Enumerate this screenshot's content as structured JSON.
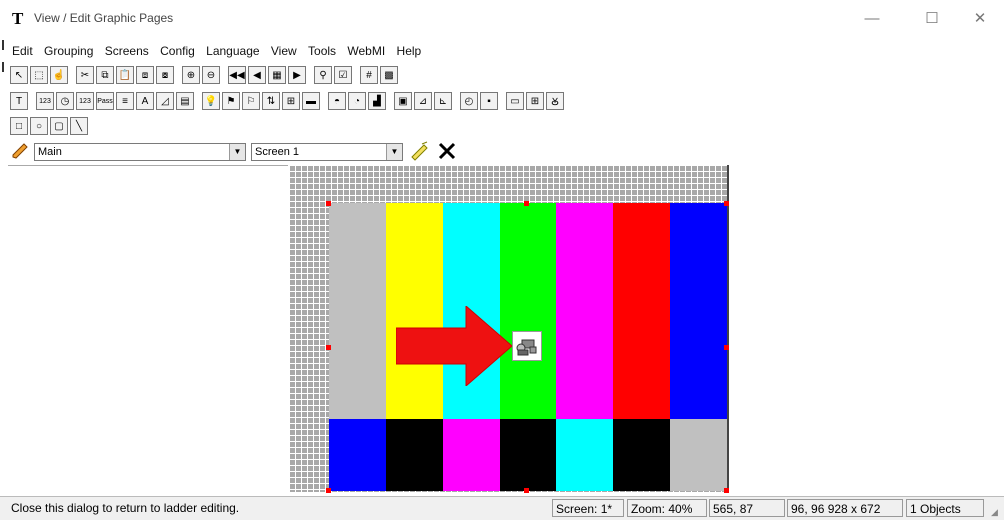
{
  "window": {
    "title": "View / Edit Graphic Pages",
    "icon_glyph": "T",
    "buttons": {
      "minimize": "—",
      "maximize": "☐",
      "close": "✕"
    }
  },
  "menu": [
    "Edit",
    "Grouping",
    "Screens",
    "Config",
    "Language",
    "View",
    "Tools",
    "WebMI",
    "Help"
  ],
  "toolbar1": [
    {
      "name": "pointer-icon",
      "glyph": "↖"
    },
    {
      "name": "select-region-icon",
      "glyph": "⬚"
    },
    {
      "name": "hand-icon",
      "glyph": "☝"
    },
    {
      "name": "cut-icon",
      "glyph": "✂"
    },
    {
      "name": "copy-icon",
      "glyph": "⧉"
    },
    {
      "name": "paste-icon",
      "glyph": "📋"
    },
    {
      "name": "bring-front-icon",
      "glyph": "⧈"
    },
    {
      "name": "send-back-icon",
      "glyph": "⧇"
    },
    {
      "name": "zoom-in-icon",
      "glyph": "⊕"
    },
    {
      "name": "zoom-out-icon",
      "glyph": "⊖"
    },
    {
      "name": "first-screen-icon",
      "glyph": "◀◀"
    },
    {
      "name": "prev-screen-icon",
      "glyph": "◀"
    },
    {
      "name": "screen-list-icon",
      "glyph": "▦"
    },
    {
      "name": "next-screen-icon",
      "glyph": "▶"
    },
    {
      "name": "find-icon",
      "glyph": "⚲"
    },
    {
      "name": "properties-icon",
      "glyph": "☑"
    },
    {
      "name": "grid-icon",
      "glyph": "#"
    },
    {
      "name": "grid-fill-icon",
      "glyph": "▩"
    }
  ],
  "toolbar2": [
    {
      "name": "text-icon",
      "glyph": "T"
    },
    {
      "name": "numeric-display-icon",
      "glyph": "123"
    },
    {
      "name": "clock-icon",
      "glyph": "◷"
    },
    {
      "name": "numeric-entry-icon",
      "glyph": "123"
    },
    {
      "name": "pass-icon",
      "glyph": "Pass"
    },
    {
      "name": "message-icon",
      "glyph": "≡"
    },
    {
      "name": "text-entry-icon",
      "glyph": "A"
    },
    {
      "name": "scale-icon",
      "glyph": "◿"
    },
    {
      "name": "table-icon",
      "glyph": "▤"
    },
    {
      "name": "lightbulb-icon",
      "glyph": "💡"
    },
    {
      "name": "flag-icon",
      "glyph": "⚑"
    },
    {
      "name": "multi-flag-icon",
      "glyph": "⚐"
    },
    {
      "name": "switch-icon",
      "glyph": "⇅"
    },
    {
      "name": "screen-button-icon",
      "glyph": "⊞"
    },
    {
      "name": "bar-graph-icon",
      "glyph": "▬"
    },
    {
      "name": "dome-light-icon",
      "glyph": "◓"
    },
    {
      "name": "meter-icon",
      "glyph": "◔"
    },
    {
      "name": "chart-icon",
      "glyph": "▟"
    },
    {
      "name": "calendar-icon",
      "glyph": "▣"
    },
    {
      "name": "trend-icon",
      "glyph": "⊿"
    },
    {
      "name": "trend-xy-icon",
      "glyph": "⊾"
    },
    {
      "name": "timer-icon",
      "glyph": "◴"
    },
    {
      "name": "save-icon",
      "glyph": "▪"
    },
    {
      "name": "camera-icon",
      "glyph": "▭"
    },
    {
      "name": "grid-table-icon",
      "glyph": "⊞"
    },
    {
      "name": "container-icon",
      "glyph": "Ꙋ"
    }
  ],
  "toolbar3": [
    {
      "name": "rectangle-icon",
      "glyph": "□"
    },
    {
      "name": "ellipse-icon",
      "glyph": "○"
    },
    {
      "name": "rounded-rect-icon",
      "glyph": "▢"
    },
    {
      "name": "line-icon",
      "glyph": "╲"
    }
  ],
  "selectors": {
    "group_value": "Main",
    "screen_value": "Screen 1"
  },
  "colors": {
    "bars_top": [
      "#c0c0c0",
      "#ffff00",
      "#00ffff",
      "#00ff00",
      "#ff00ff",
      "#ff0000",
      "#0000ff"
    ],
    "bars_bottom": [
      "#0000ff",
      "#000000",
      "#ff00ff",
      "#000000",
      "#00ffff",
      "#000000",
      "#c0c0c0"
    ],
    "arrow": "#ee1111"
  },
  "status": {
    "message": "Close this dialog to return to ladder editing.",
    "screen": "Screen: 1*",
    "zoom": "Zoom: 40%",
    "cursor": "565, 87",
    "size": "96, 96  928 x 672",
    "objects": "1 Objects"
  }
}
